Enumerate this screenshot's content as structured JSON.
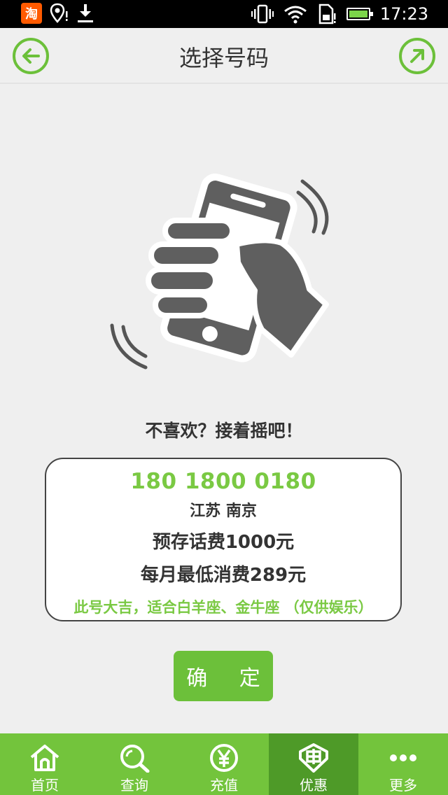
{
  "status_bar": {
    "app_badge": "淘",
    "time": "17:23"
  },
  "header": {
    "title": "选择号码",
    "back_icon": "arrow-left-circle-icon",
    "forward_icon": "arrow-up-right-circle-icon"
  },
  "hero": {
    "icon": "shake-phone-hand-icon"
  },
  "prompt": "不喜欢？接着摇吧！",
  "number_card": {
    "number": "180 1800 0180",
    "location": "江苏  南京",
    "prestore": "预存话费1000元",
    "monthly_min": "每月最低消费289元",
    "fortune": "此号大吉，适合白羊座、金牛座 （仅供娱乐）"
  },
  "confirm_button": "确 定",
  "bottom_nav": {
    "items": [
      {
        "label": "首页",
        "icon": "home-icon"
      },
      {
        "label": "查询",
        "icon": "search-icon"
      },
      {
        "label": "充值",
        "icon": "yuan-coin-icon"
      },
      {
        "label": "优惠",
        "icon": "discount-tag-icon",
        "active": true
      },
      {
        "label": "更多",
        "icon": "more-dots-icon"
      }
    ]
  },
  "colors": {
    "accent": "#73c43c",
    "accent_dark": "#4e9a28",
    "number_green": "#7ac943"
  }
}
